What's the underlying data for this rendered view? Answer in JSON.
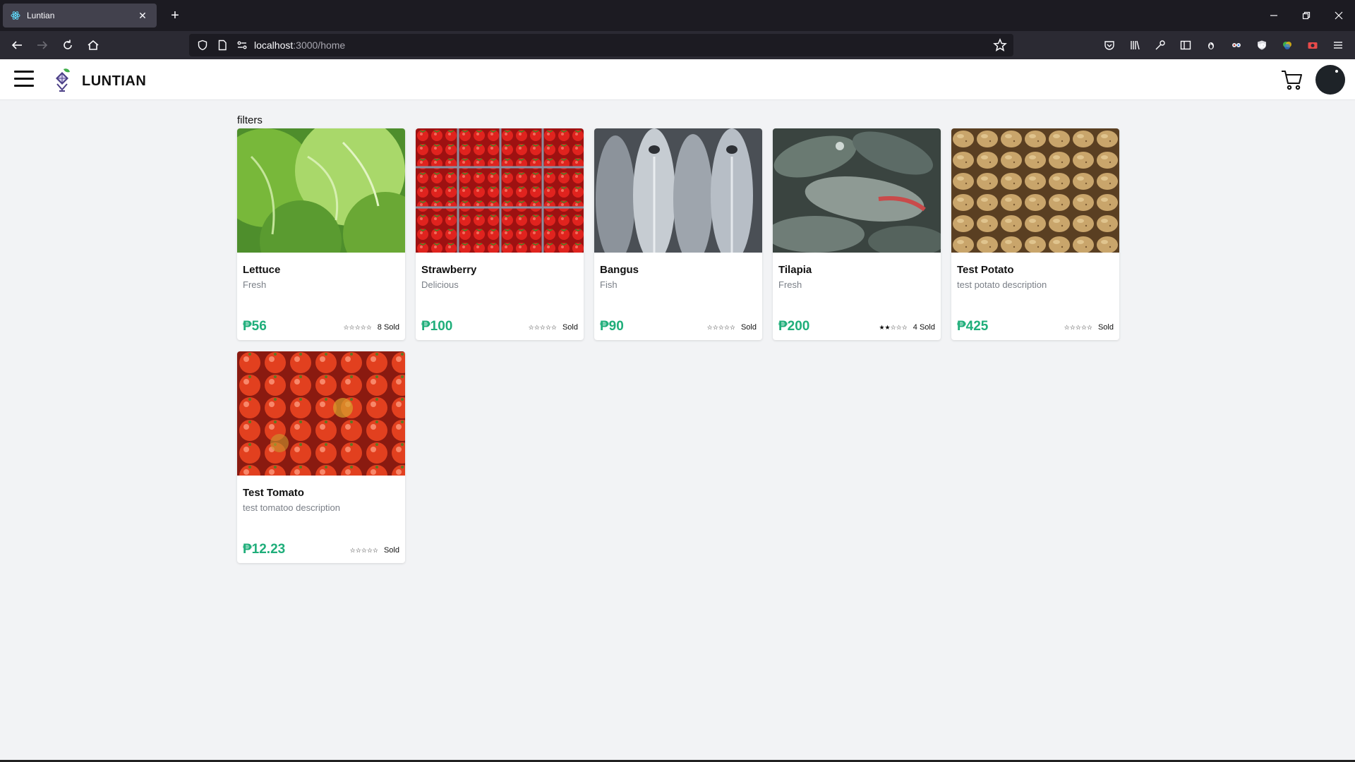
{
  "browser": {
    "tab_title": "Luntian",
    "url_host": "localhost",
    "url_rest": ":3000/home"
  },
  "app": {
    "brand": "LUNTIAN",
    "filters_label": "filters"
  },
  "products": [
    {
      "name": "Lettuce",
      "description": "Fresh",
      "price": "₱56",
      "stars": "☆☆☆☆☆",
      "rating": 0,
      "sold": "8 Sold",
      "image_icon": "lettuce-image"
    },
    {
      "name": "Strawberry",
      "description": "Delicious",
      "price": "₱100",
      "stars": "☆☆☆☆☆",
      "rating": 0,
      "sold": "Sold",
      "image_icon": "strawberry-image"
    },
    {
      "name": "Bangus",
      "description": "Fish",
      "price": "₱90",
      "stars": "☆☆☆☆☆",
      "rating": 0,
      "sold": "Sold",
      "image_icon": "bangus-fish-image"
    },
    {
      "name": "Tilapia",
      "description": "Fresh",
      "price": "₱200",
      "stars": "★★☆☆☆",
      "rating": 2,
      "sold": "4 Sold",
      "image_icon": "tilapia-fish-image"
    },
    {
      "name": "Test Potato",
      "description": "test potato description",
      "price": "₱425",
      "stars": "☆☆☆☆☆",
      "rating": 0,
      "sold": "Sold",
      "image_icon": "potato-image"
    },
    {
      "name": "Test Tomato",
      "description": "test tomatoo description",
      "price": "₱12.23",
      "stars": "☆☆☆☆☆",
      "rating": 0,
      "sold": "Sold",
      "image_icon": "tomato-image"
    }
  ],
  "colors": {
    "price": "#1fae7a",
    "page_bg": "#f2f3f5",
    "browser_dark": "#1c1b22"
  }
}
